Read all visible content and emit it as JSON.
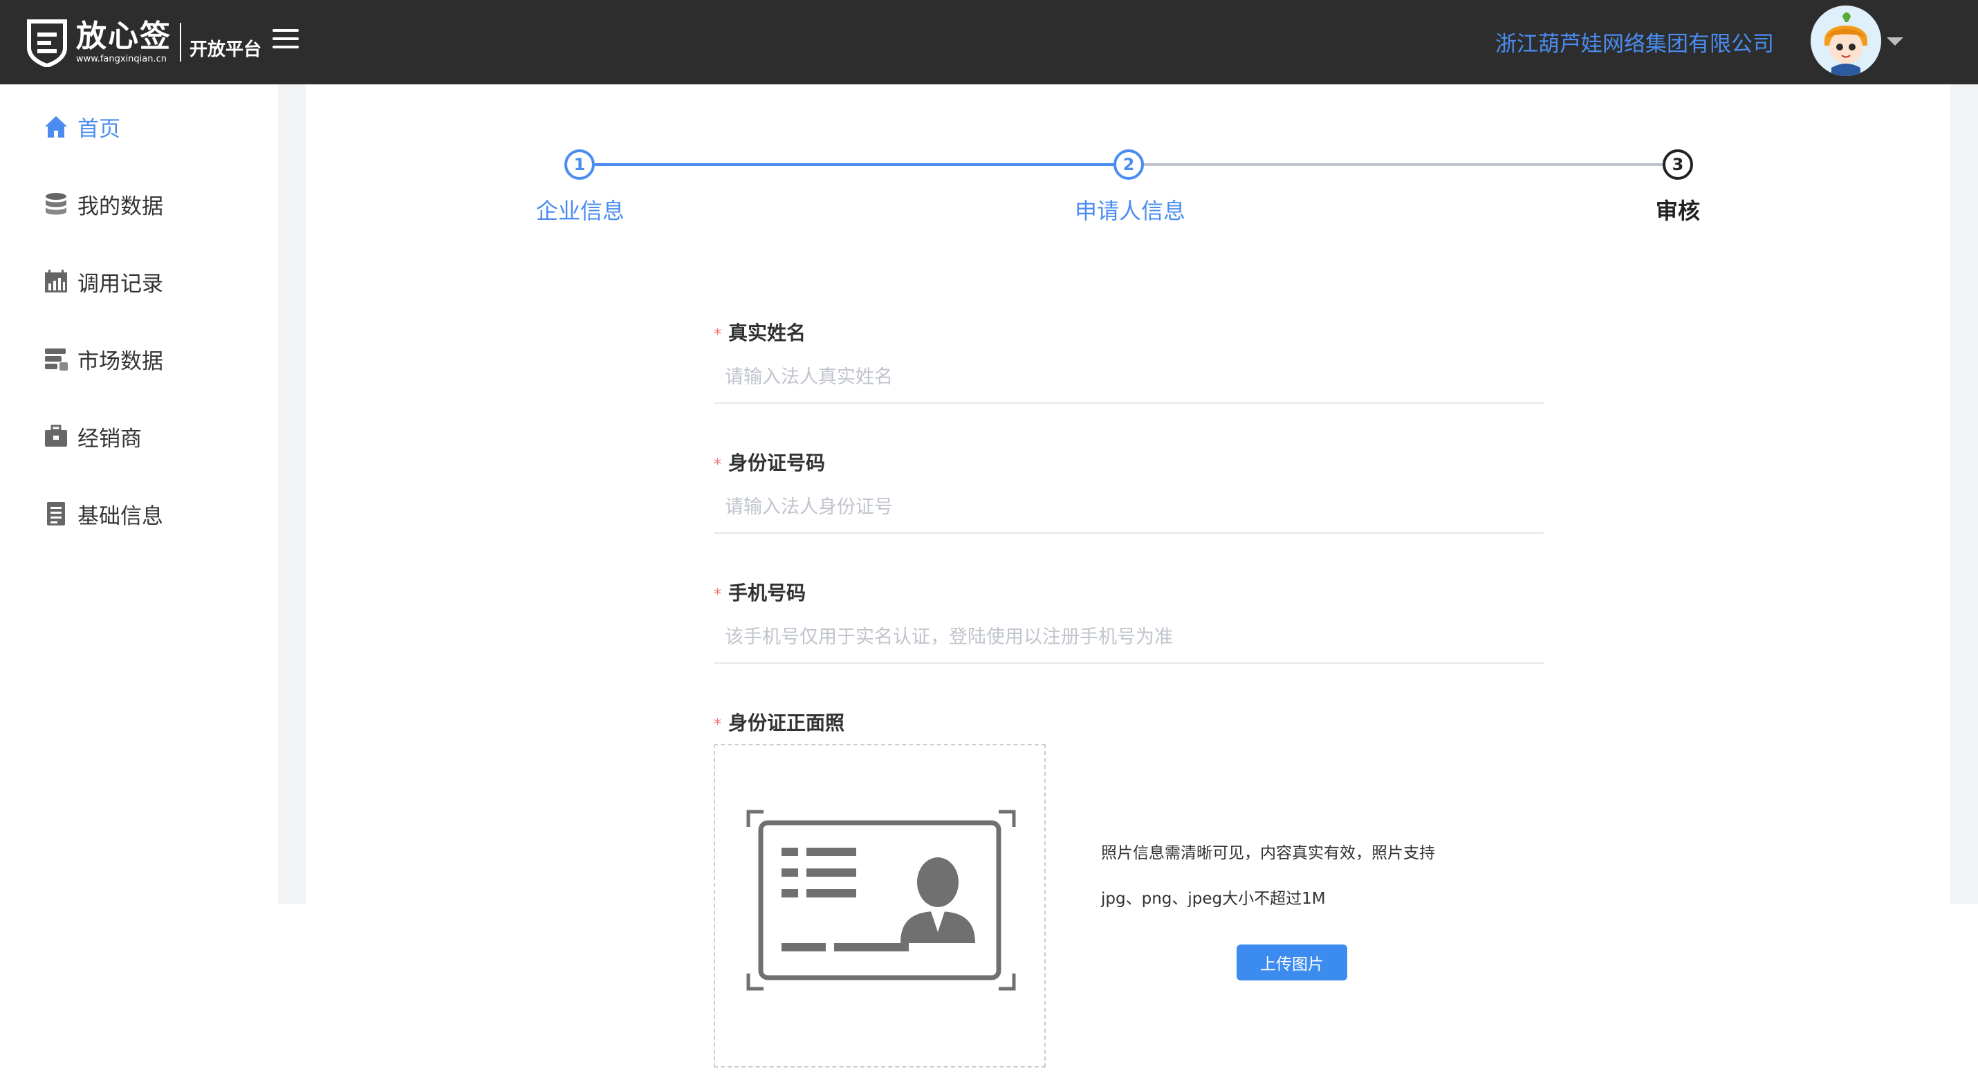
{
  "header": {
    "logo_name": "放心签",
    "logo_url": "www.fangxinqian.cn",
    "platform": "开放平台",
    "company": "浙江葫芦娃网络集团有限公司"
  },
  "sidebar": {
    "items": [
      {
        "label": "首页",
        "icon": "home-icon",
        "active": true
      },
      {
        "label": "我的数据",
        "icon": "database-icon"
      },
      {
        "label": "调用记录",
        "icon": "calendar-chart-icon"
      },
      {
        "label": "市场数据",
        "icon": "server-stack-icon"
      },
      {
        "label": "经销商",
        "icon": "briefcase-icon"
      },
      {
        "label": "基础信息",
        "icon": "document-icon"
      }
    ]
  },
  "steps": [
    {
      "num": "1",
      "label": "企业信息"
    },
    {
      "num": "2",
      "label": "申请人信息"
    },
    {
      "num": "3",
      "label": "审核"
    }
  ],
  "form": {
    "name": {
      "label": "真实姓名",
      "placeholder": "请输入法人真实姓名"
    },
    "idnum": {
      "label": "身份证号码",
      "placeholder": "请输入法人身份证号"
    },
    "phone": {
      "label": "手机号码",
      "placeholder": "该手机号仅用于实名认证，登陆使用以注册手机号为准"
    },
    "idphoto": {
      "label": "身份证正面照",
      "tip1": "照片信息需清晰可见，内容真实有效，照片支持",
      "tip2": "jpg、png、jpeg大小不超过1M",
      "button": "上传图片"
    }
  },
  "colors": {
    "accent": "#4a8cf0",
    "header_bg": "#2d2d2d",
    "required": "#f56c6c",
    "button": "#3c8bee"
  }
}
